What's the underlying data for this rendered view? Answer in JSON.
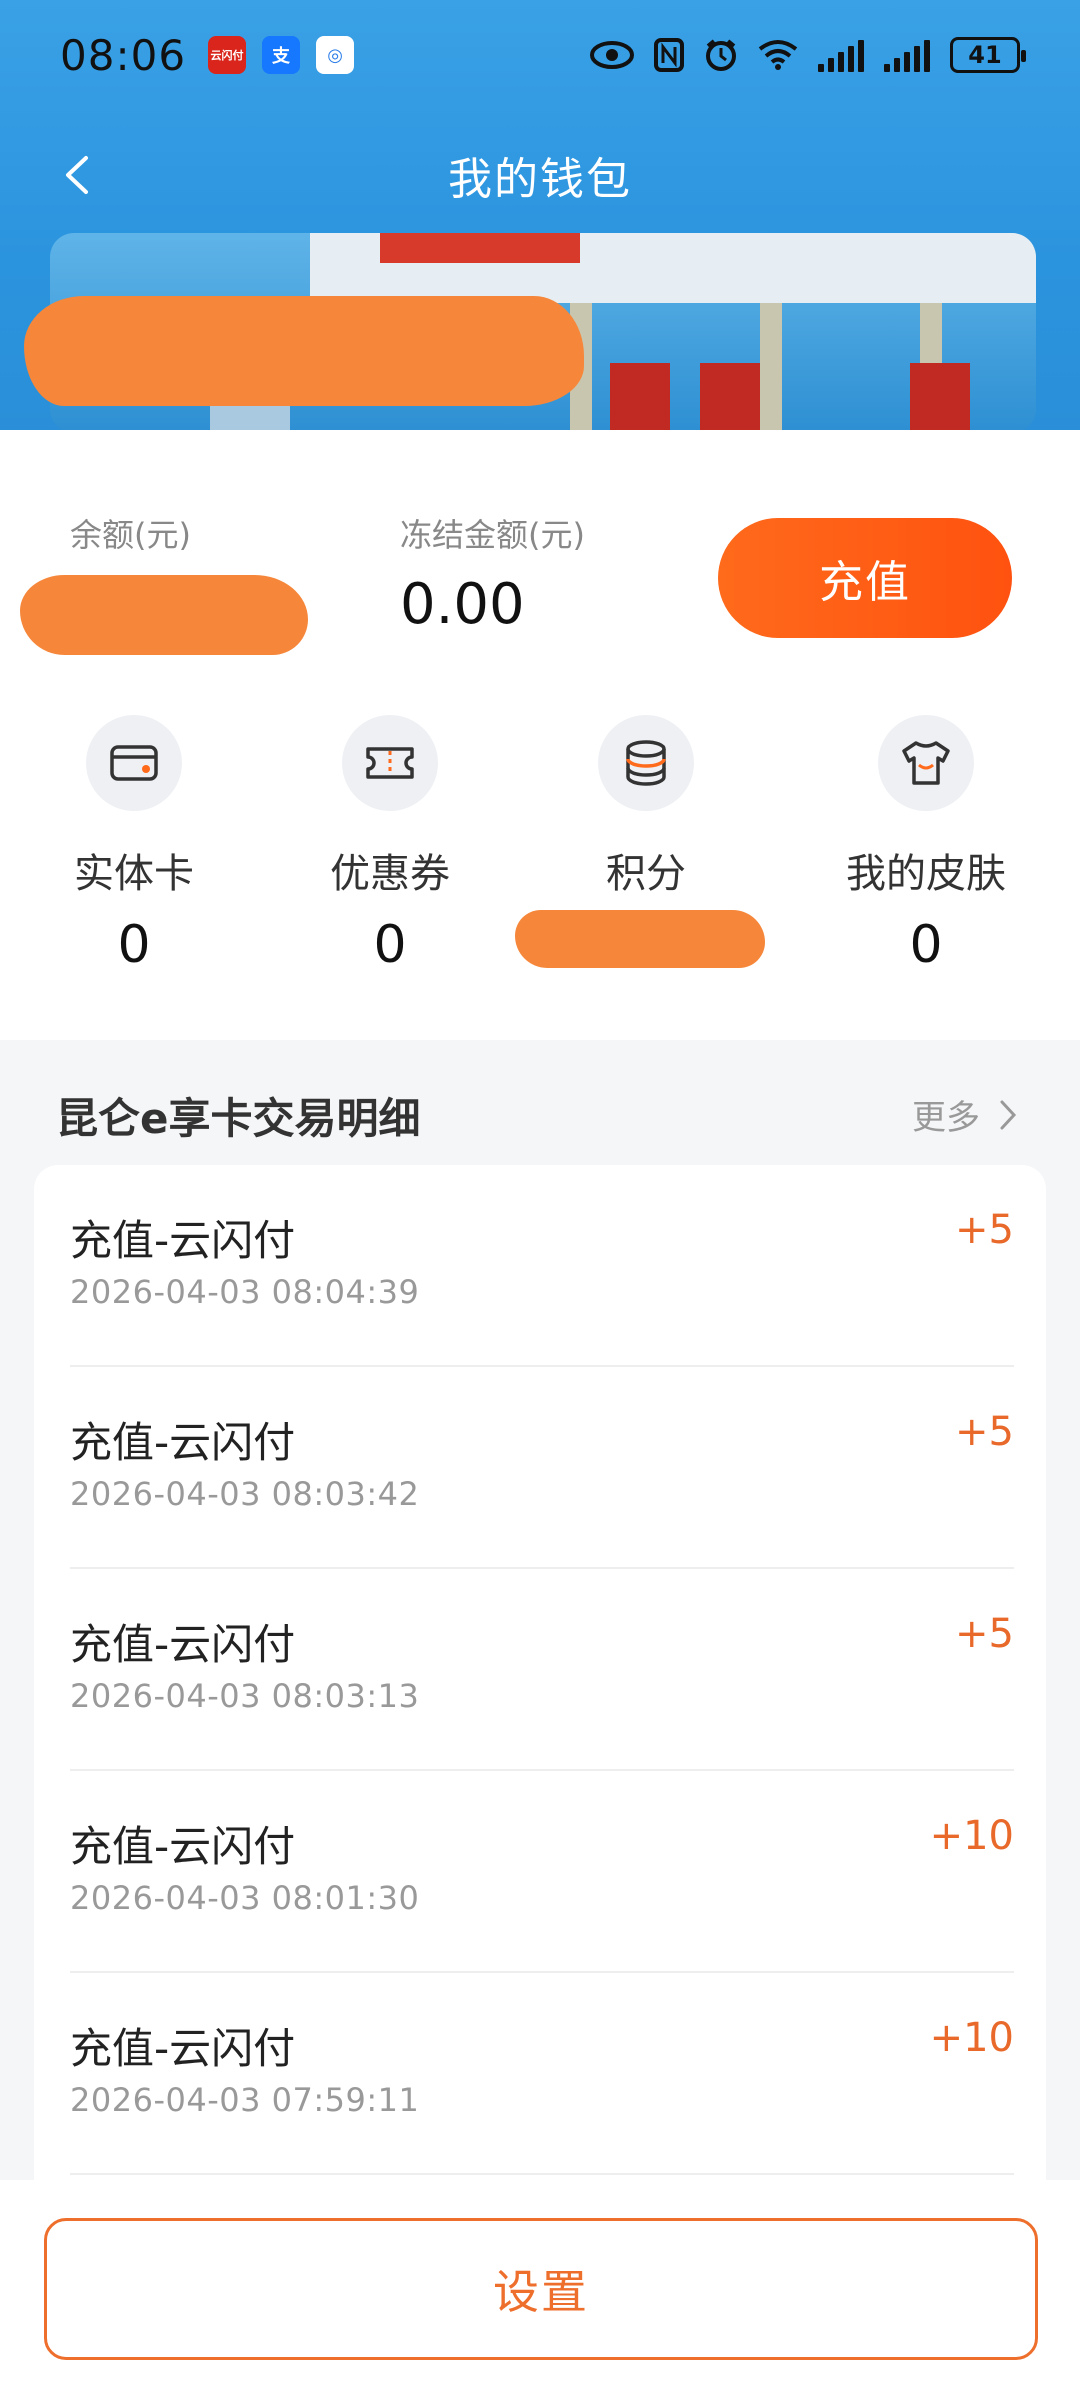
{
  "status_bar": {
    "time": "08:06",
    "battery": "41",
    "app_badges": [
      {
        "name": "unionpay-app-icon",
        "color": "#d9251c",
        "text": "云闪付"
      },
      {
        "name": "alipay-app-icon",
        "color": "#1677ff",
        "text": "支"
      },
      {
        "name": "other-app-icon",
        "color": "#2b7de9",
        "text": "◎"
      }
    ]
  },
  "nav": {
    "title": "我的钱包"
  },
  "wallet": {
    "balance_label": "余额(元)",
    "frozen_label": "冻结金额(元)",
    "frozen_value": "0.00",
    "recharge_label": "充值"
  },
  "features": [
    {
      "label": "实体卡",
      "value": "0",
      "icon": "card-icon"
    },
    {
      "label": "优惠券",
      "value": "0",
      "icon": "coupon-icon"
    },
    {
      "label": "积分",
      "value": "",
      "icon": "coins-icon"
    },
    {
      "label": "我的皮肤",
      "value": "0",
      "icon": "shirt-icon"
    }
  ],
  "transactions": {
    "title": "昆仑e享卡交易明细",
    "more_label": "更多",
    "items": [
      {
        "title": "充值-云闪付",
        "time": "2026-04-03 08:04:39",
        "amount": "+5"
      },
      {
        "title": "充值-云闪付",
        "time": "2026-04-03 08:03:42",
        "amount": "+5"
      },
      {
        "title": "充值-云闪付",
        "time": "2026-04-03 08:03:13",
        "amount": "+5"
      },
      {
        "title": "充值-云闪付",
        "time": "2026-04-03 08:01:30",
        "amount": "+10"
      },
      {
        "title": "充值-云闪付",
        "time": "2026-04-03 07:59:11",
        "amount": "+10"
      }
    ]
  },
  "footer": {
    "settings_label": "设置"
  },
  "colors": {
    "accent": "#ff5a14",
    "amount": "#e8692a",
    "header_blue": "#2b94de"
  }
}
